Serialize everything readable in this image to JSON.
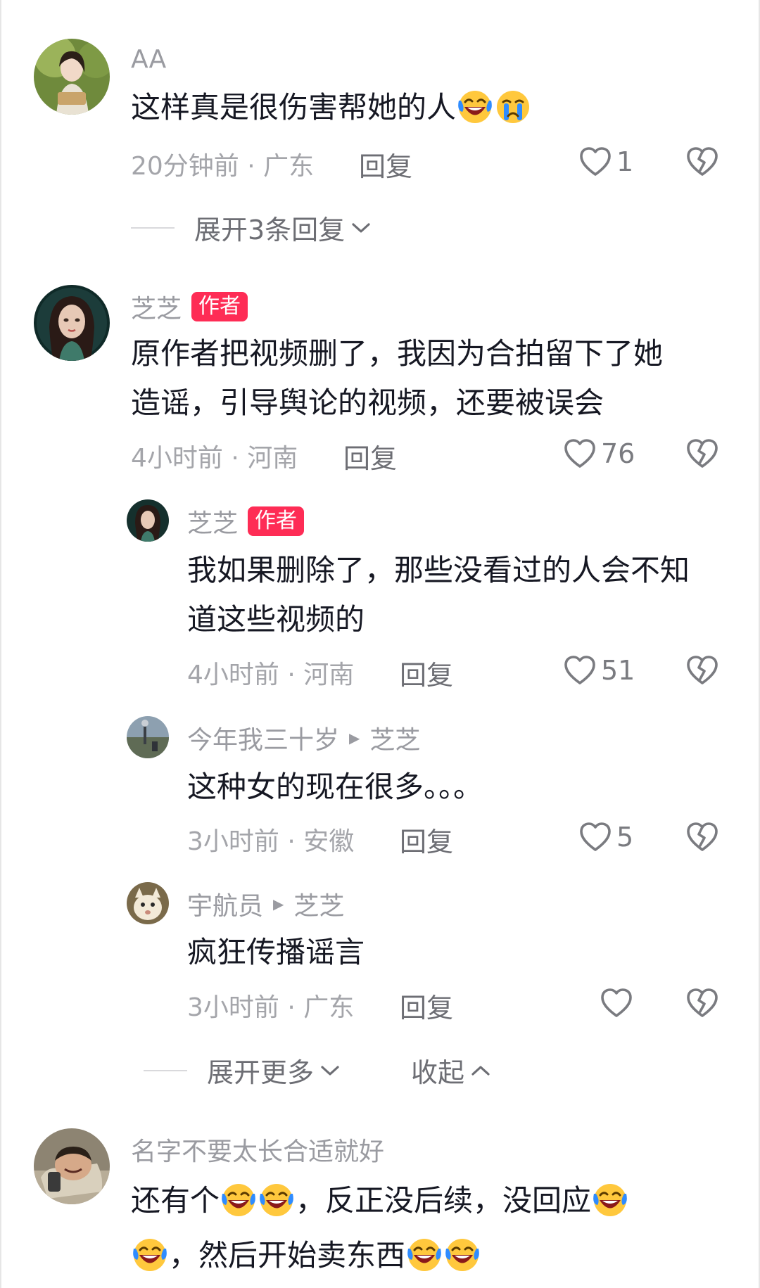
{
  "comments": [
    {
      "name": "AA",
      "text": "这样真是很伤害帮她的人",
      "time_location": "20分钟前 · 广东",
      "reply_label": "回复",
      "likes": "1",
      "expand_label": "展开3条回复"
    },
    {
      "name": "芝芝",
      "badge": "作者",
      "text_line1": "原作者把视频删了，我因为合拍留下了她",
      "text_line2": "造谣，引导舆论的视频，还要被误会",
      "time_location": "4小时前 · 河南",
      "reply_label": "回复",
      "likes": "76",
      "replies": [
        {
          "name": "芝芝",
          "badge": "作者",
          "text_line1": "我如果删除了，那些没看过的人会不知",
          "text_line2": "道这些视频的",
          "time_location": "4小时前 · 河南",
          "reply_label": "回复",
          "likes": "51"
        },
        {
          "name": "今年我三十岁",
          "reply_to": "芝芝",
          "text": "这种女的现在很多。。。",
          "time_location": "3小时前 · 安徽",
          "reply_label": "回复",
          "likes": "5"
        },
        {
          "name": "宇航员",
          "reply_to": "芝芝",
          "text": "疯狂传播谣言",
          "time_location": "3小时前 · 广东",
          "reply_label": "回复",
          "likes": ""
        }
      ],
      "expand_more_label": "展开更多",
      "collapse_label": "收起"
    },
    {
      "name": "名字不要太长合适就好",
      "text_part1": "还有个",
      "text_part2": "，反正没后续，没回应",
      "text_part3": "，然后开始卖东西"
    }
  ],
  "icons": {
    "like": "heart-outline-icon",
    "dislike": "broken-heart-icon",
    "emoji_laugh": "laughing-crying-emoji",
    "emoji_cry": "crying-emoji"
  },
  "colors": {
    "author_badge": "#fe2c55",
    "emoji_yellow": "#ffc83d",
    "tear_blue": "#2f8cff"
  }
}
